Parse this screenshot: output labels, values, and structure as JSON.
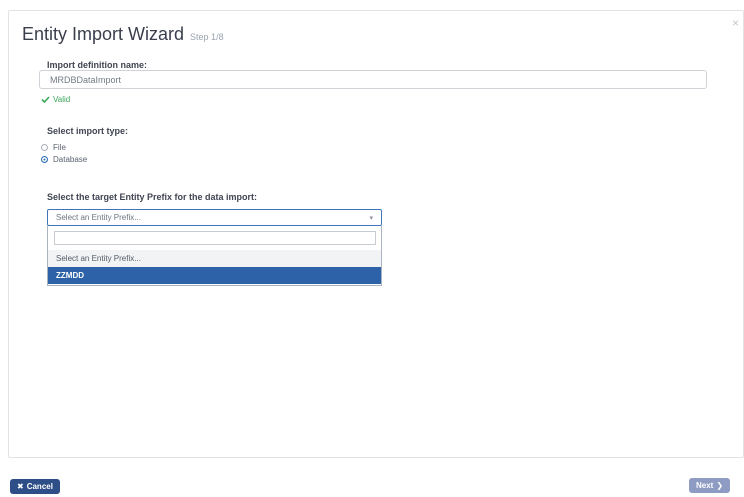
{
  "modal": {
    "title": "Entity Import Wizard",
    "step": "Step 1/8",
    "close_glyph": "×"
  },
  "form": {
    "definition_label": "Import definition name:",
    "definition_value": "MRDBDataImport",
    "valid_text": "Valid",
    "import_type_label": "Select import type:",
    "import_types": [
      {
        "label": "File",
        "checked": false
      },
      {
        "label": "Database",
        "checked": true
      }
    ],
    "prefix_label": "Select the target Entity Prefix for the data import:",
    "prefix_select": {
      "selected_text": "Select an Entity Prefix...",
      "search_value": "",
      "options": [
        "Select an Entity Prefix...",
        "ZZMDD"
      ],
      "highlighted_index": 1
    }
  },
  "footer": {
    "cancel_label": "Cancel",
    "next_label": "Next"
  },
  "colors": {
    "accent": "#2d62a8",
    "cancel_bg": "#2d4e86",
    "next_bg": "#8e9cc4",
    "valid": "#3aa65a"
  }
}
